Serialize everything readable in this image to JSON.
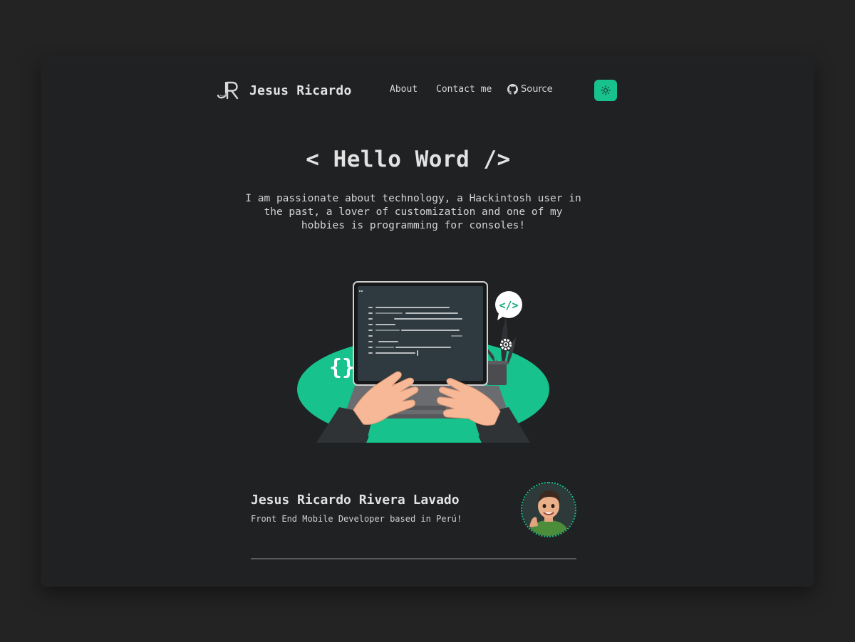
{
  "header": {
    "brand_name": "Jesus Ricardo",
    "logo_icon": "jr-monogram-icon",
    "nav": {
      "about_label": "About",
      "contact_label": "Contact me",
      "source_label": "Source",
      "source_icon": "github-icon"
    },
    "theme_toggle_icon": "sun-icon"
  },
  "hero": {
    "title": "< Hello Word />",
    "description": "I am passionate about technology, a Hackintosh user in the past, a lover of customization and one of my hobbies is programming for consoles!",
    "illustration": {
      "braces_text": "{}",
      "code_bubble_text": "</>"
    }
  },
  "profile": {
    "name": "Jesus Ricardo Rivera Lavado",
    "role": "Front End Mobile Developer based in Perú!",
    "avatar_icon": "memoji-avatar"
  },
  "colors": {
    "page_background": "#232324",
    "card_background": "#202123",
    "accent": "#17c28c",
    "text": "#e2e2e2",
    "divider": "#5b5b5e"
  }
}
